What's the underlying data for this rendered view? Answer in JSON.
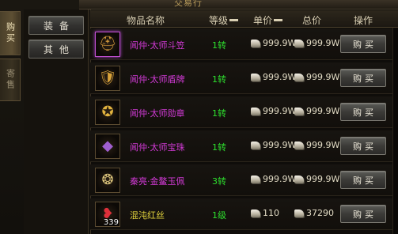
{
  "window": {
    "title": "交易行"
  },
  "tabs": {
    "buy": "购买",
    "sell": "寄售"
  },
  "categories": {
    "equip": "装备",
    "other": "其他"
  },
  "header": {
    "name": "物品名称",
    "level": "等级",
    "unit_price": "单价",
    "total_price": "总价",
    "operation": "操作"
  },
  "colors": {
    "name_purple": "#d23ad6",
    "level_green": "#2ee02e",
    "accent_gold": "#b79a5a"
  },
  "rows": [
    {
      "icon": "helmet-icon",
      "name": "闻仲·太师斗笠",
      "level": "1转",
      "unit": "999.9W",
      "total": "999.9W",
      "button": "购买",
      "qty": "",
      "name_color": "#d23ad6"
    },
    {
      "icon": "shield-icon",
      "name": "闻仲·太师盾牌",
      "level": "1转",
      "unit": "999.9W",
      "total": "999.9W",
      "button": "购买",
      "qty": "",
      "name_color": "#d23ad6"
    },
    {
      "icon": "medal-icon",
      "name": "闻仲·太师勋章",
      "level": "1转",
      "unit": "999.9W",
      "total": "999.9W",
      "button": "购买",
      "qty": "",
      "name_color": "#d23ad6"
    },
    {
      "icon": "gem-icon",
      "name": "闻仲·太师宝珠",
      "level": "1转",
      "unit": "999.9W",
      "total": "999.9W",
      "button": "购买",
      "qty": "",
      "name_color": "#d23ad6"
    },
    {
      "icon": "jade-pendant-icon",
      "name": "秦亮·金鳌玉佩",
      "level": "3转",
      "unit": "999.9W",
      "total": "999.9W",
      "button": "购买",
      "qty": "",
      "name_color": "#d23ad6"
    },
    {
      "icon": "red-silk-icon",
      "name": "混沌红丝",
      "level": "1级",
      "unit": "110",
      "total": "37290",
      "button": "购买",
      "qty": "339",
      "name_color": "#e0d23c"
    }
  ]
}
